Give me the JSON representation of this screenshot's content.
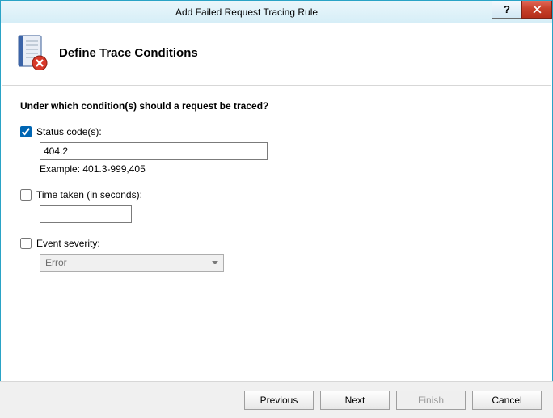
{
  "window": {
    "title": "Add Failed Request Tracing Rule"
  },
  "header": {
    "title": "Define Trace Conditions"
  },
  "content": {
    "prompt": "Under which condition(s) should a request be traced?",
    "status_codes": {
      "label": "Status code(s):",
      "checked": true,
      "value": "404.2",
      "example": "Example: 401.3-999,405"
    },
    "time_taken": {
      "label": "Time taken (in seconds):",
      "checked": false,
      "value": ""
    },
    "event_severity": {
      "label": "Event severity:",
      "checked": false,
      "selected": "Error"
    }
  },
  "footer": {
    "previous": "Previous",
    "next": "Next",
    "finish": "Finish",
    "cancel": "Cancel"
  }
}
